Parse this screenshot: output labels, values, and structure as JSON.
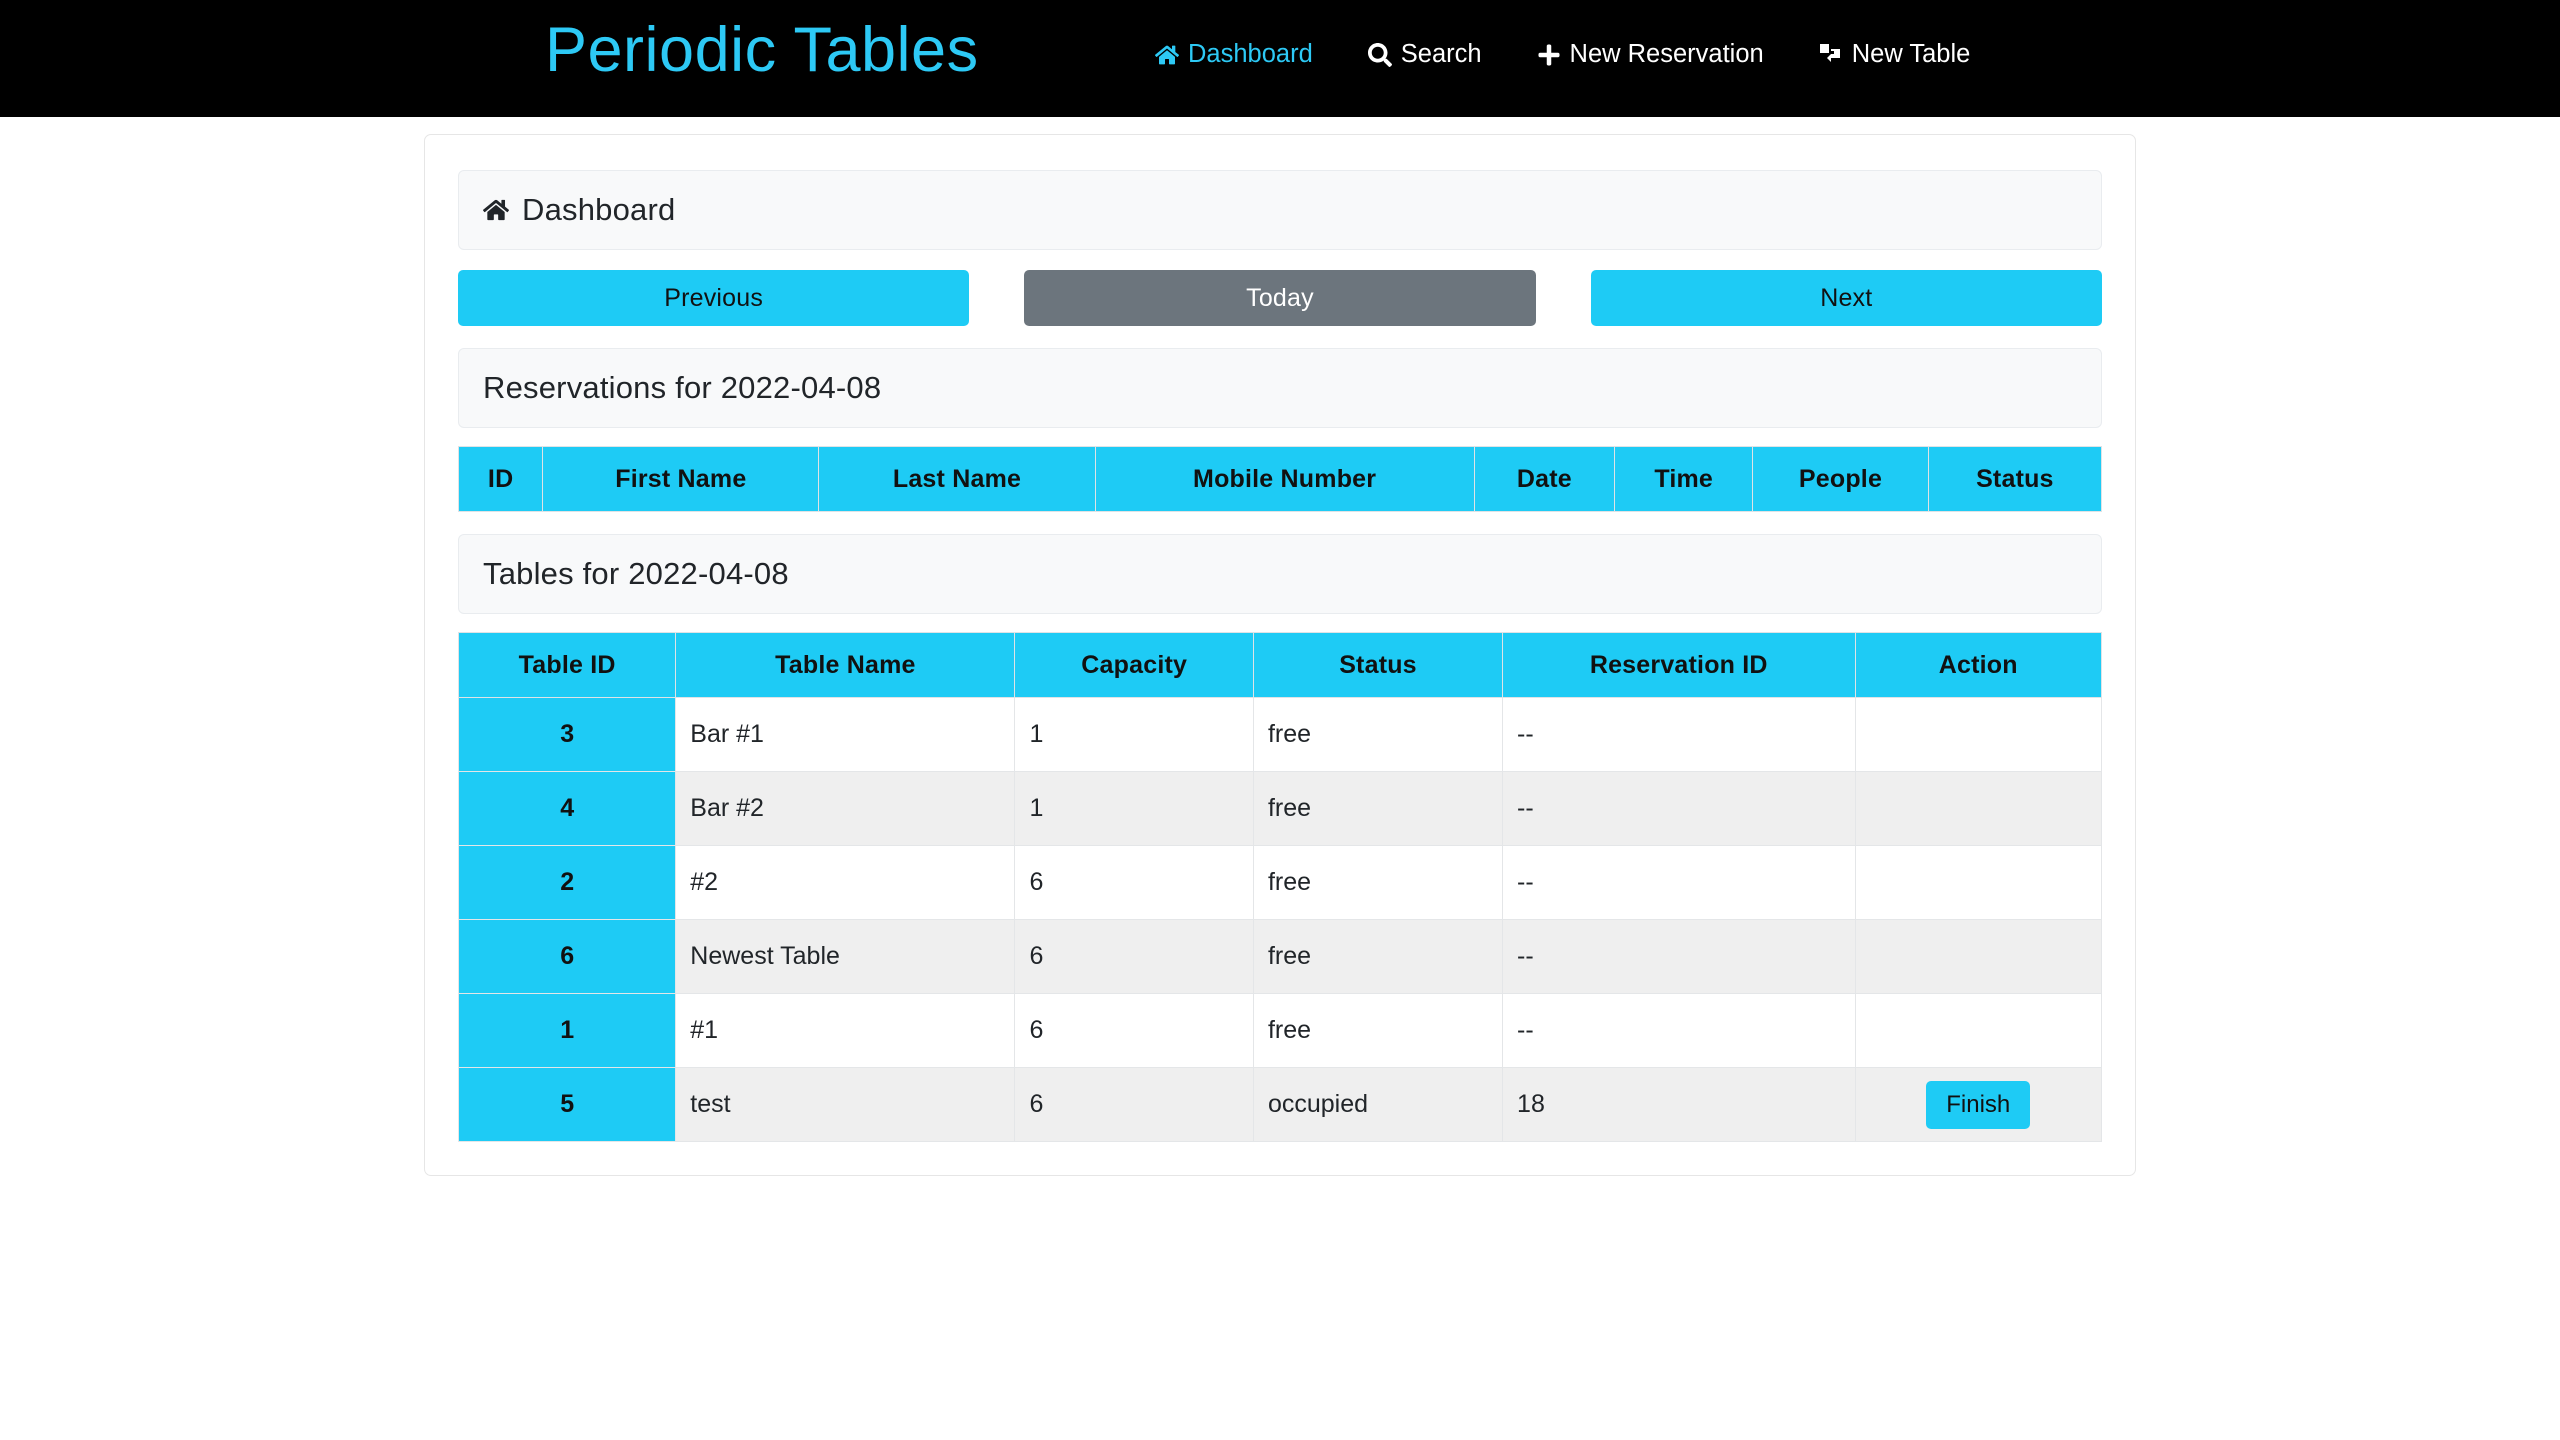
{
  "navbar": {
    "brand": "Periodic Tables",
    "links": [
      {
        "label": "Dashboard",
        "icon": "home-icon",
        "active": true
      },
      {
        "label": "Search",
        "icon": "search-icon",
        "active": false
      },
      {
        "label": "New Reservation",
        "icon": "plus-icon",
        "active": false
      },
      {
        "label": "New Table",
        "icon": "new-table-icon",
        "active": false
      }
    ]
  },
  "dashboard": {
    "header": "Dashboard",
    "header_icon": "home-icon",
    "buttons": {
      "previous": "Previous",
      "today": "Today",
      "next": "Next"
    }
  },
  "reservations": {
    "title": "Reservations for 2022-04-08",
    "date": "2022-04-08",
    "columns": [
      "ID",
      "First Name",
      "Last Name",
      "Mobile Number",
      "Date",
      "Time",
      "People",
      "Status"
    ],
    "rows": []
  },
  "tables": {
    "title": "Tables for 2022-04-08",
    "date": "2022-04-08",
    "columns": [
      "Table ID",
      "Table Name",
      "Capacity",
      "Status",
      "Reservation ID",
      "Action"
    ],
    "rows": [
      {
        "table_id": "3",
        "table_name": "Bar #1",
        "capacity": "1",
        "status": "free",
        "reservation_id": "--",
        "action": ""
      },
      {
        "table_id": "4",
        "table_name": "Bar #2",
        "capacity": "1",
        "status": "free",
        "reservation_id": "--",
        "action": ""
      },
      {
        "table_id": "2",
        "table_name": "#2",
        "capacity": "6",
        "status": "free",
        "reservation_id": "--",
        "action": ""
      },
      {
        "table_id": "6",
        "table_name": "Newest Table",
        "capacity": "6",
        "status": "free",
        "reservation_id": "--",
        "action": ""
      },
      {
        "table_id": "1",
        "table_name": "#1",
        "capacity": "6",
        "status": "free",
        "reservation_id": "--",
        "action": ""
      },
      {
        "table_id": "5",
        "table_name": "test",
        "capacity": "6",
        "status": "occupied",
        "reservation_id": "18",
        "action": "Finish"
      }
    ]
  },
  "colors": {
    "accent_cyan": "#1ecbf5",
    "brand_cyan": "#2dc9f5",
    "navbar_black": "#000000",
    "secondary_gray": "#6c757d",
    "card_header_bg": "#f8f9fa",
    "row_stripe": "#efefef"
  }
}
